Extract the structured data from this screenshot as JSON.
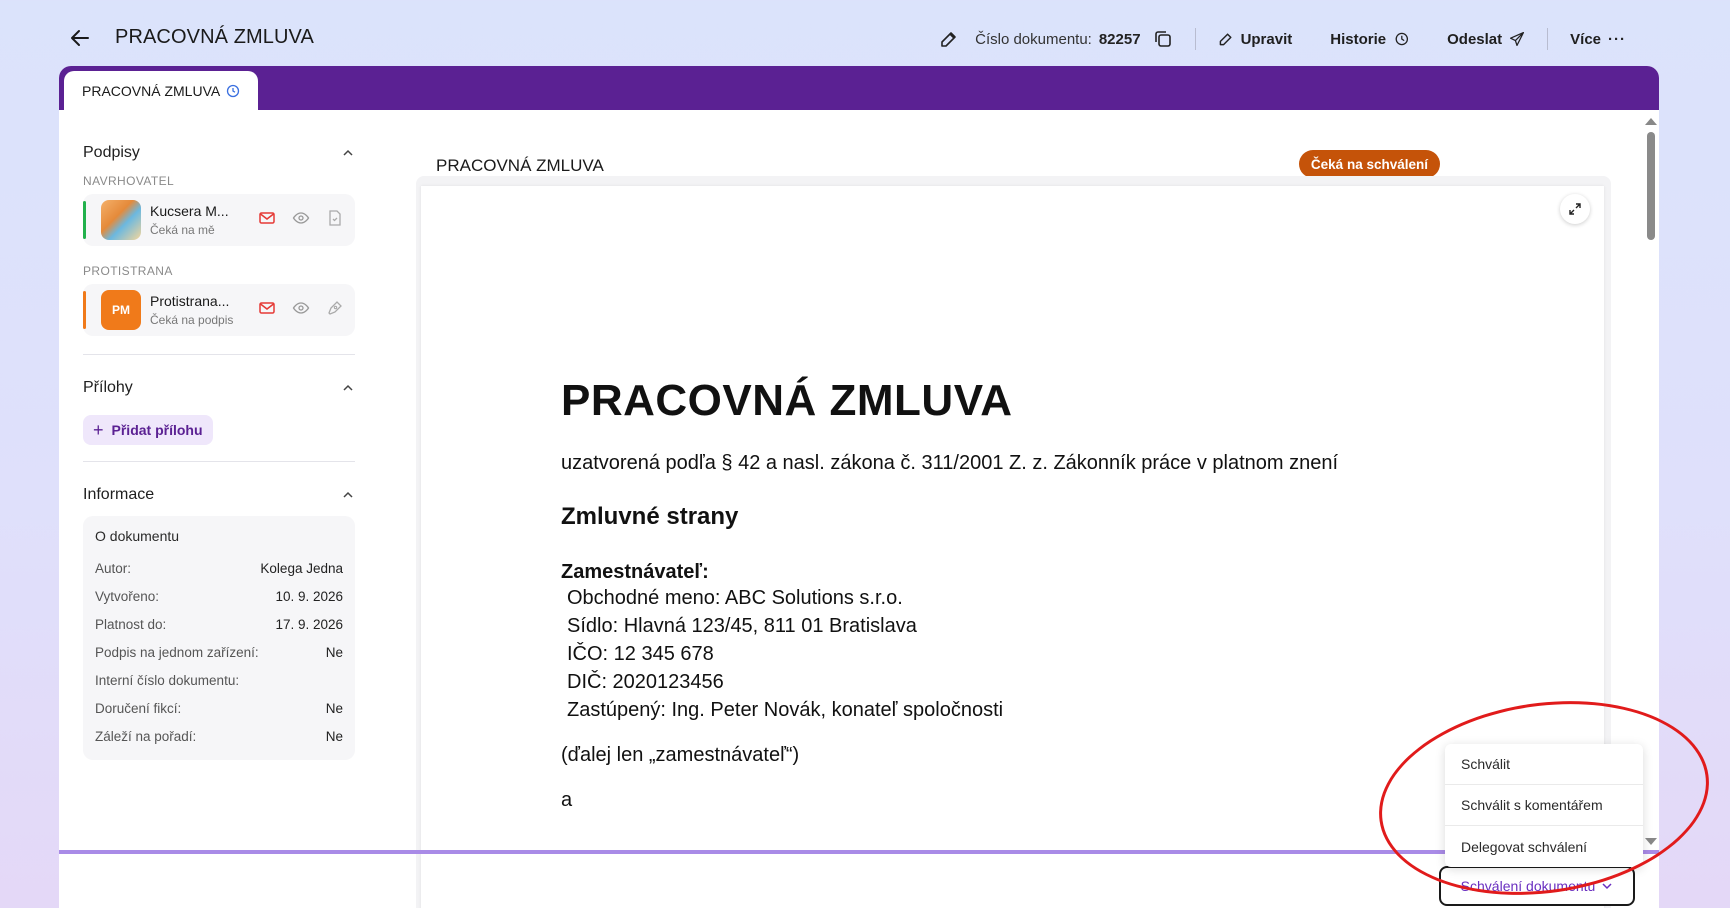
{
  "header": {
    "title": "PRACOVNÁ ZMLUVA",
    "doc_number_label": "Číslo dokumentu:",
    "doc_number": "82257",
    "edit_label": "Upravit",
    "history_label": "Historie",
    "send_label": "Odeslat",
    "more_label": "Více"
  },
  "tab": {
    "label": "PRACOVNÁ ZMLUVA"
  },
  "sidebar": {
    "signatures_title": "Podpisy",
    "proposer_label": "NAVRHOVATEL",
    "proposer": {
      "name": "Kucsera M...",
      "status": "Čeká na mě"
    },
    "counterparty_label": "PROTISTRANA",
    "counterparty": {
      "initials": "PM",
      "name": "Protistrana...",
      "status": "Čeká na podpis"
    },
    "attachments_title": "Přílohy",
    "add_attachment": "Přidat přílohu",
    "info_title": "Informace",
    "about_doc": "O dokumentu",
    "info_rows": [
      {
        "key": "Autor:",
        "value": "Kolega Jedna"
      },
      {
        "key": "Vytvořeno:",
        "value": "10. 9. 2026"
      },
      {
        "key": "Platnost do:",
        "value": "17. 9. 2026"
      },
      {
        "key": "Podpis na jednom zařízení:",
        "value": "Ne"
      },
      {
        "key": "Interní číslo dokumentu:",
        "value": ""
      },
      {
        "key": "Doručení fikcí:",
        "value": "Ne"
      },
      {
        "key": "Záleží na pořadí:",
        "value": "Ne"
      }
    ],
    "colors": {
      "proposer_bar": "#22b14c",
      "counterparty_bar": "#f07a1a",
      "pm_avatar": "#f07a1a"
    }
  },
  "document": {
    "panel_title": "PRACOVNÁ ZMLUVA",
    "status": "Čeká na schválení",
    "status_color": "#c55309",
    "h1": "PRACOVNÁ ZMLUVA",
    "subtitle": "uzatvorená podľa § 42 a nasl. zákona č. 311/2001 Z. z. Zákonník práce v platnom znení",
    "h2": "Zmluvné strany",
    "employer_head": "Zamestnávateľ:",
    "employer_lines": [
      "Obchodné meno: ABC Solutions s.r.o.",
      "Sídlo: Hlavná 123/45, 811 01 Bratislava",
      "IČO: 12 345 678",
      "DIČ: 2020123456",
      "Zastúpený: Ing. Peter Novák, konateľ spoločnosti"
    ],
    "para1": "(ďalej len „zamestnávateľ“)",
    "para2": "a"
  },
  "approval": {
    "button_label": "Schválení dokumentu",
    "menu": [
      "Schválit",
      "Schválit s komentářem",
      "Delegovat schválení"
    ]
  },
  "colors": {
    "tabstrip": "#5b2193",
    "accent": "#6a2fc0",
    "annotation": "#e11b1b"
  }
}
